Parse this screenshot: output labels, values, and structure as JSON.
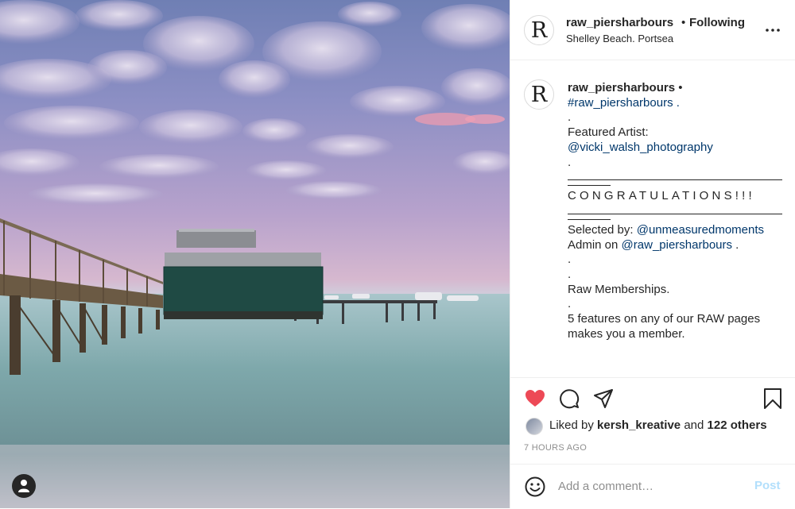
{
  "post": {
    "username": "raw_piersharbours",
    "separator": "•",
    "follow_status": "Following",
    "location": "Shelley Beach. Portsea",
    "avatar_letter": "R"
  },
  "caption": {
    "username": "raw_piersharbours",
    "bullet": "•",
    "lines": [
      "#raw_piersharbours .",
      ".",
      "Featured Artist:",
      "@vicki_walsh_photography",
      ".",
      "CONGRATULATIONS!!!",
      "Selected by:",
      "@unmeasuredmoments",
      "Admin on",
      "@raw_piersharbours",
      ".",
      ".",
      ".",
      "Raw Memberships.",
      ".",
      "5 features on any of our RAW pages",
      "makes you a member."
    ]
  },
  "likes": {
    "prefix": "Liked by",
    "user": "kersh_kreative",
    "joiner": "and",
    "others": "122 others"
  },
  "timestamp": "7 HOURS AGO",
  "comment": {
    "placeholder": "Add a comment…",
    "post_label": "Post"
  },
  "icons": {
    "like": "heart-icon",
    "comment": "comment-icon",
    "share": "share-icon",
    "save": "bookmark-icon",
    "emoji": "emoji-icon",
    "more": "more-options-icon",
    "user": "user-icon"
  },
  "colors": {
    "like_active": "#ed4956",
    "link": "#00376b",
    "muted": "#8e8e8e",
    "post_disabled": "#b2dffc"
  }
}
